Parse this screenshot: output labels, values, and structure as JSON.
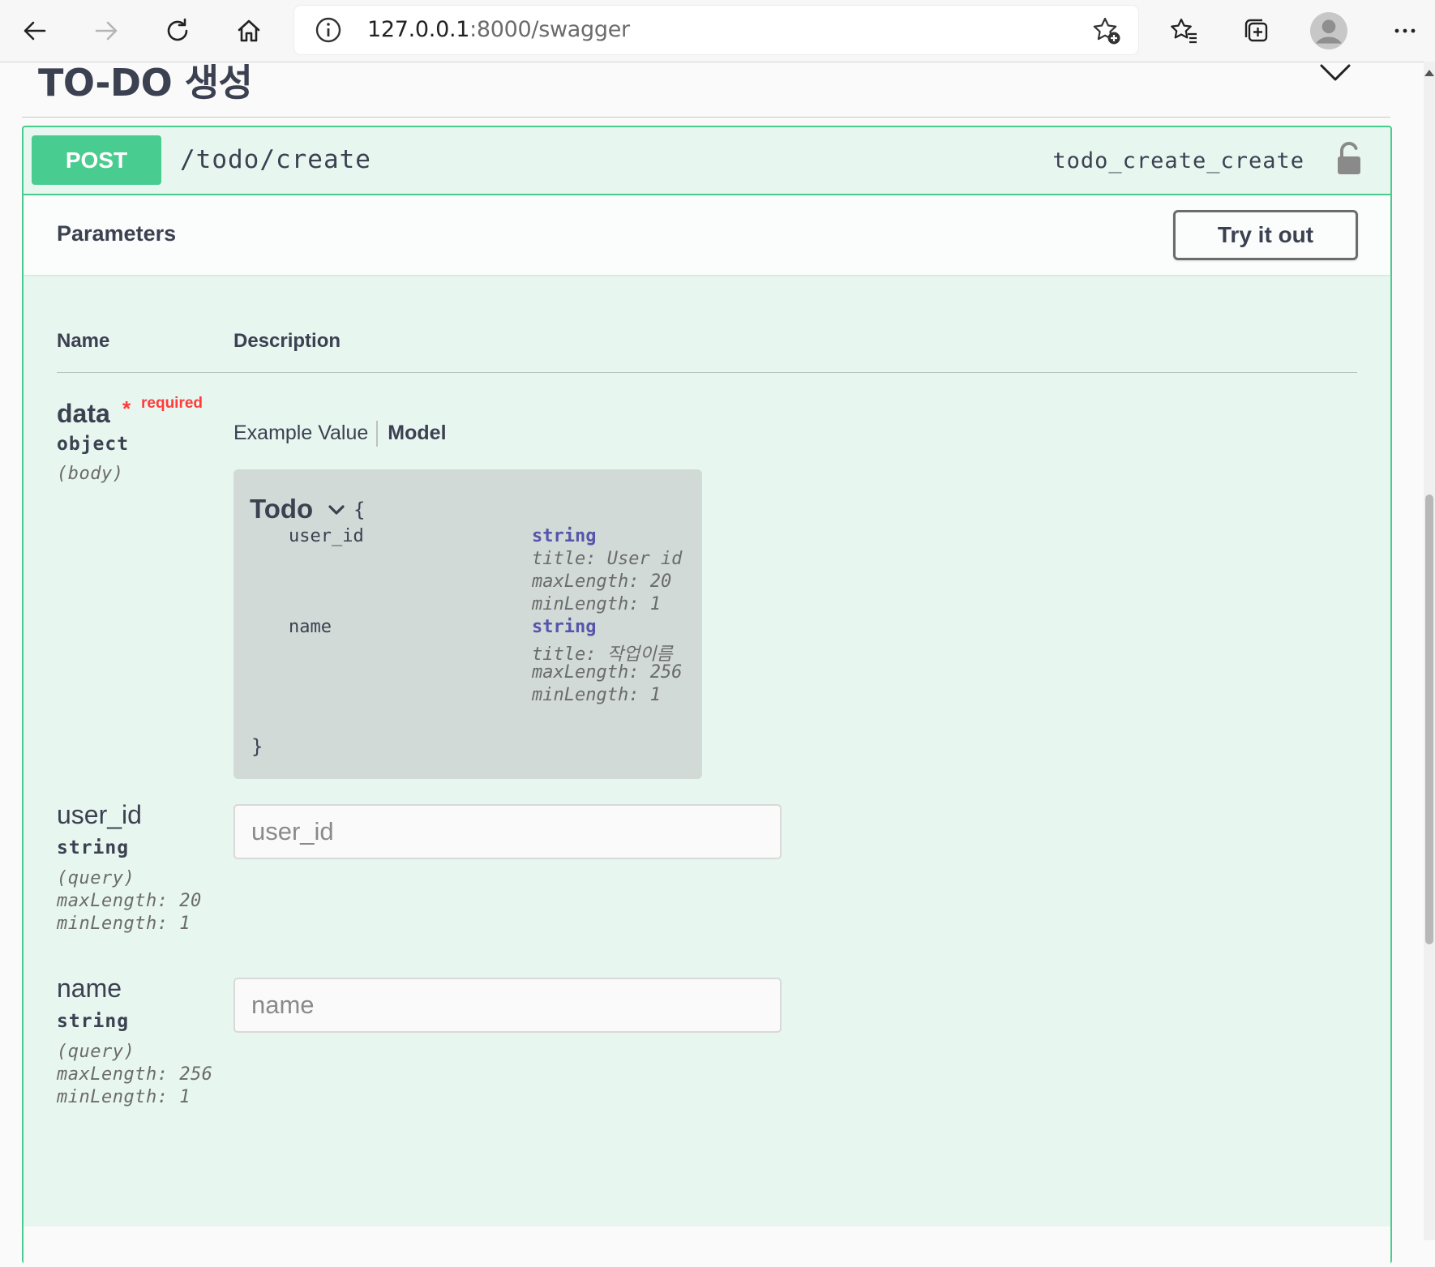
{
  "browser": {
    "url_host": "127.0.0.1",
    "url_rest": ":8000/swagger",
    "icons": [
      "back-arrow-icon",
      "forward-arrow-icon",
      "refresh-icon",
      "home-icon",
      "info-icon",
      "add-favorite-icon",
      "favorites-icon",
      "collections-icon",
      "profile-icon",
      "more-icon"
    ]
  },
  "section": {
    "title": "TO-DO 생성"
  },
  "operation": {
    "method": "POST",
    "path": "/todo/create",
    "operation_id": "todo_create_create",
    "accent_color": "#49cc90"
  },
  "parameters": {
    "title": "Parameters",
    "try_label": "Try it out",
    "col_name": "Name",
    "col_description": "Description",
    "body_param": {
      "name": "data",
      "required_star": "*",
      "required_label": "required",
      "type": "object",
      "in": "(body)",
      "tab_example": "Example Value",
      "tab_model": "Model",
      "model": {
        "title": "Todo",
        "open_brace": "{",
        "close_brace": "}",
        "props": [
          {
            "name": "user_id",
            "type": "string",
            "title": "title: User id",
            "max": "maxLength: 20",
            "min": "minLength: 1"
          },
          {
            "name": "name",
            "type": "string",
            "title": "title: 작업이름",
            "max": "maxLength: 256",
            "min": "minLength: 1"
          }
        ]
      }
    },
    "query_params": [
      {
        "name": "user_id",
        "type": "string",
        "in": "(query)",
        "max": "maxLength: 20",
        "min": "minLength: 1",
        "placeholder": "user_id"
      },
      {
        "name": "name",
        "type": "string",
        "in": "(query)",
        "max": "maxLength: 256",
        "min": "minLength: 1",
        "placeholder": "name"
      }
    ]
  }
}
